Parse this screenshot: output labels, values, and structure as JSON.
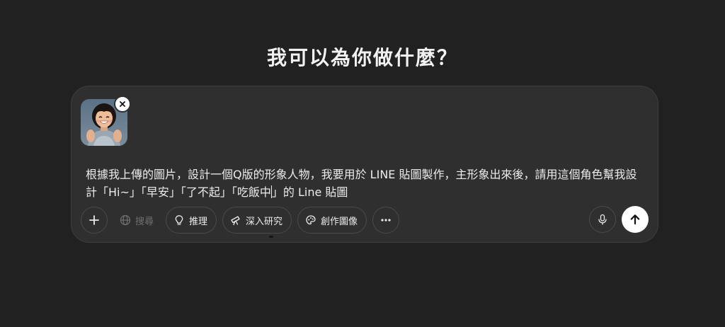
{
  "heading": "我可以為你做什麼？",
  "attachment": {
    "remove_icon": "close-icon"
  },
  "prompt": {
    "text_before_caret": "根據我上傳的圖片，設計一個Q版的形象人物，我要用於 LINE 貼圖製作，主形象出來後，請用這個角色幫我設計「Hi~」「早安」「了不起」「吃飯中",
    "text_after_caret": "」的 Line 貼圖"
  },
  "toolbar": {
    "add_icon": "plus-icon",
    "search_label": "搜尋",
    "reason_label": "推理",
    "deep_research_label": "深入研究",
    "create_image_label": "創作圖像",
    "more_icon": "ellipsis-icon",
    "mic_icon": "microphone-icon",
    "send_icon": "arrow-up-icon"
  },
  "colors": {
    "background": "#212121",
    "composer": "#2f2f2f",
    "send_button": "#ffffff"
  }
}
